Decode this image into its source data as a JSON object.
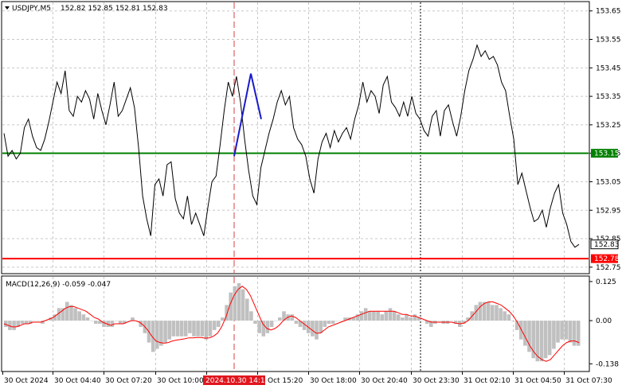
{
  "header": {
    "symbol": "USDJPY,M5",
    "ohlc": "152.82 152.85 152.81 152.83",
    "indicator": "MACD(12,26,9) -0.059 -0.047"
  },
  "price_scale": {
    "labels": [
      "153.65",
      "153.55",
      "153.45",
      "153.35",
      "153.25",
      "153.15",
      "153.05",
      "152.95",
      "152.85",
      "152.75"
    ],
    "current_price": "152.83",
    "green_level": "153.15",
    "red_level": "152.78"
  },
  "macd_scale": {
    "labels": [
      "0.125",
      "0.00",
      "-0.138"
    ]
  },
  "time_axis": {
    "labels": [
      "30 Oct 2024",
      "30 Oct 04:40",
      "30 Oct 07:20",
      "30 Oct 10:00",
      "2024.10.30 14:10",
      "Oct 15:20",
      "30 Oct 18:00",
      "30 Oct 20:40",
      "30 Oct 23:30",
      "31 Oct 02:10",
      "31 Oct 04:50",
      "31 Oct 07:30"
    ],
    "highlight_index": 4
  },
  "colors": {
    "price_line": "#000000",
    "green_level": "#008000",
    "red_level": "#ff0000",
    "current_price_box": "#ffffff",
    "signal_line": "#ff0000",
    "histogram": "#c0c0c0",
    "arrow": "#1a1acc",
    "grid": "#c8c8c8",
    "highlight_bg": "#e0161e",
    "vline_red": "#d94040"
  },
  "chart_data": {
    "type": "line",
    "title": "USDJPY,M5",
    "ylim": [
      152.73,
      153.68
    ],
    "price_series": [
      153.22,
      153.14,
      153.16,
      153.13,
      153.15,
      153.24,
      153.27,
      153.21,
      153.17,
      153.16,
      153.2,
      153.26,
      153.33,
      153.4,
      153.36,
      153.44,
      153.3,
      153.28,
      153.35,
      153.33,
      153.37,
      153.34,
      153.27,
      153.36,
      153.3,
      153.25,
      153.32,
      153.4,
      153.28,
      153.3,
      153.34,
      153.38,
      153.31,
      153.17,
      153.0,
      152.92,
      152.86,
      153.04,
      153.06,
      153.0,
      153.11,
      153.12,
      152.99,
      152.94,
      152.92,
      153.0,
      152.9,
      152.94,
      152.9,
      152.86,
      152.96,
      153.05,
      153.07,
      153.18,
      153.3,
      153.4,
      153.35,
      153.42,
      153.33,
      153.2,
      153.09,
      153.0,
      152.97,
      153.1,
      153.16,
      153.22,
      153.27,
      153.33,
      153.37,
      153.32,
      153.35,
      153.24,
      153.2,
      153.18,
      153.14,
      153.06,
      153.01,
      153.13,
      153.19,
      153.22,
      153.17,
      153.23,
      153.19,
      153.22,
      153.24,
      153.2,
      153.27,
      153.32,
      153.4,
      153.33,
      153.37,
      153.35,
      153.29,
      153.39,
      153.42,
      153.33,
      153.31,
      153.28,
      153.33,
      153.28,
      153.35,
      153.29,
      153.27,
      153.23,
      153.21,
      153.28,
      153.3,
      153.21,
      153.3,
      153.32,
      153.26,
      153.21,
      153.28,
      153.37,
      153.44,
      153.48,
      153.53,
      153.49,
      153.51,
      153.48,
      153.49,
      153.46,
      153.4,
      153.37,
      153.28,
      153.2,
      153.04,
      153.08,
      153.02,
      152.96,
      152.91,
      152.92,
      152.95,
      152.89,
      152.96,
      153.01,
      153.04,
      152.94,
      152.9,
      152.84,
      152.82,
      152.83
    ]
  },
  "macd_data": {
    "ylim": [
      -0.16,
      0.14
    ],
    "histogram": [
      -0.02,
      -0.03,
      -0.03,
      -0.02,
      -0.01,
      -0.01,
      -0.01,
      0.0,
      0.0,
      -0.01,
      0.0,
      0.01,
      0.02,
      0.04,
      0.04,
      0.06,
      0.05,
      0.04,
      0.03,
      0.02,
      0.01,
      0.0,
      -0.01,
      -0.01,
      -0.02,
      -0.02,
      -0.02,
      0.0,
      -0.01,
      -0.01,
      0.0,
      0.01,
      0.0,
      -0.02,
      -0.04,
      -0.07,
      -0.1,
      -0.09,
      -0.08,
      -0.07,
      -0.06,
      -0.05,
      -0.05,
      -0.05,
      -0.05,
      -0.04,
      -0.05,
      -0.05,
      -0.05,
      -0.06,
      -0.05,
      -0.03,
      -0.02,
      0.01,
      0.05,
      0.09,
      0.11,
      0.12,
      0.1,
      0.07,
      0.03,
      -0.01,
      -0.04,
      -0.05,
      -0.04,
      -0.02,
      0.0,
      0.01,
      0.03,
      0.02,
      0.02,
      -0.01,
      -0.02,
      -0.03,
      -0.04,
      -0.05,
      -0.06,
      -0.04,
      -0.02,
      -0.01,
      -0.01,
      0.0,
      0.0,
      0.01,
      0.01,
      0.01,
      0.02,
      0.03,
      0.04,
      0.03,
      0.03,
      0.03,
      0.02,
      0.03,
      0.04,
      0.03,
      0.02,
      0.01,
      0.02,
      0.01,
      0.02,
      0.01,
      0.0,
      -0.01,
      -0.02,
      -0.01,
      0.0,
      -0.01,
      -0.01,
      0.0,
      -0.01,
      -0.02,
      -0.01,
      0.01,
      0.03,
      0.05,
      0.06,
      0.06,
      0.06,
      0.05,
      0.05,
      0.04,
      0.03,
      0.02,
      0.0,
      -0.03,
      -0.06,
      -0.08,
      -0.1,
      -0.12,
      -0.13,
      -0.13,
      -0.12,
      -0.11,
      -0.09,
      -0.07,
      -0.06,
      -0.06,
      -0.07,
      -0.08,
      -0.08
    ],
    "signal": [
      -0.01,
      -0.015,
      -0.02,
      -0.02,
      -0.015,
      -0.01,
      -0.01,
      -0.005,
      -0.005,
      -0.005,
      0.0,
      0.005,
      0.01,
      0.02,
      0.03,
      0.04,
      0.045,
      0.045,
      0.04,
      0.035,
      0.03,
      0.02,
      0.01,
      0.005,
      -0.005,
      -0.01,
      -0.015,
      -0.01,
      -0.01,
      -0.01,
      -0.005,
      0.0,
      0.0,
      -0.005,
      -0.015,
      -0.03,
      -0.05,
      -0.065,
      -0.07,
      -0.072,
      -0.07,
      -0.065,
      -0.062,
      -0.06,
      -0.058,
      -0.055,
      -0.055,
      -0.054,
      -0.054,
      -0.056,
      -0.055,
      -0.05,
      -0.04,
      -0.02,
      0.01,
      0.05,
      0.08,
      0.1,
      0.11,
      0.1,
      0.08,
      0.05,
      0.02,
      -0.01,
      -0.025,
      -0.03,
      -0.025,
      -0.015,
      0.0,
      0.01,
      0.015,
      0.01,
      0.0,
      -0.01,
      -0.02,
      -0.03,
      -0.04,
      -0.04,
      -0.03,
      -0.02,
      -0.015,
      -0.01,
      -0.005,
      0.0,
      0.005,
      0.01,
      0.015,
      0.02,
      0.025,
      0.03,
      0.03,
      0.03,
      0.03,
      0.03,
      0.03,
      0.03,
      0.025,
      0.02,
      0.02,
      0.015,
      0.015,
      0.01,
      0.005,
      0.0,
      -0.005,
      -0.005,
      -0.005,
      -0.005,
      -0.005,
      -0.005,
      -0.008,
      -0.01,
      -0.008,
      0.0,
      0.015,
      0.03,
      0.045,
      0.055,
      0.06,
      0.06,
      0.055,
      0.05,
      0.04,
      0.03,
      0.015,
      -0.005,
      -0.03,
      -0.055,
      -0.08,
      -0.1,
      -0.115,
      -0.125,
      -0.13,
      -0.125,
      -0.11,
      -0.095,
      -0.08,
      -0.07,
      -0.065,
      -0.065,
      -0.07
    ]
  }
}
